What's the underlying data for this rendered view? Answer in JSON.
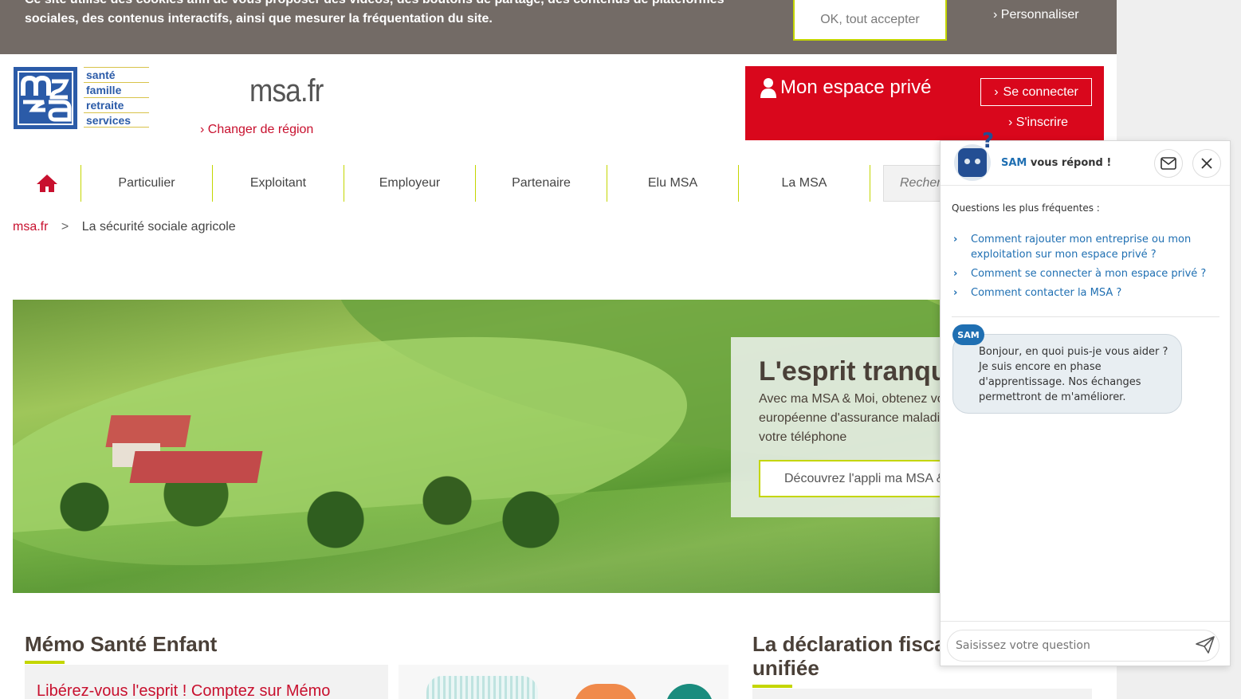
{
  "cookie": {
    "text": "Ce site utilise des cookies afin de vous proposer des vidéos, des boutons de partage, des contenus de plateformes sociales, des contenus interactifs, ainsi que mesurer la fréquentation du site.",
    "accept_label": "OK, tout accepter",
    "customize_label": "Personnaliser"
  },
  "header": {
    "logo_words": [
      "santé",
      "famille",
      "retraite",
      "services"
    ],
    "site_name": "msa.fr",
    "change_region": "Changer de région",
    "espace_title": "Mon espace privé",
    "login_label": "Se connecter",
    "register_label": "S'inscrire"
  },
  "nav": {
    "items": [
      "Particulier",
      "Exploitant",
      "Employeur",
      "Partenaire",
      "Elu MSA",
      "La MSA"
    ],
    "search_placeholder": "Rechercher"
  },
  "breadcrumb": {
    "home": "msa.fr",
    "separator": ">",
    "current": "La sécurité sociale agricole"
  },
  "hero": {
    "title": "L'esprit tranquille",
    "description": "Avec ma MSA & Moi, obtenez votre carte européenne d'assurance maladie directement sur votre téléphone",
    "cta": "Découvrez l'appli ma MSA & Moi"
  },
  "sections": {
    "memo_title": "Mémo Santé Enfant",
    "memo_link": "Libérez-vous l'esprit ! Comptez sur Mémo",
    "decl_title": "La déclaration fiscale unifiée"
  },
  "chat": {
    "bot_name": "SAM",
    "header_suffix": "vous répond !",
    "faq_title": "Questions les plus fréquentes :",
    "faq": [
      "Comment rajouter mon entreprise ou mon exploitation sur mon espace privé ?",
      "Comment se connecter à mon espace privé ?",
      "Comment contacter la MSA ?"
    ],
    "badge": "SAM",
    "message": "Bonjour, en quoi puis-je vous aider ? Je suis encore en phase d'apprentissage. Nos échanges permettront de m'améliorer.",
    "input_placeholder": "Saisissez votre question"
  },
  "colors": {
    "brand_red": "#d9071c",
    "accent_green": "#c4d600",
    "msa_blue": "#2b5ba8",
    "chat_blue": "#1f6fb2",
    "cookie_bg": "#736b66"
  }
}
